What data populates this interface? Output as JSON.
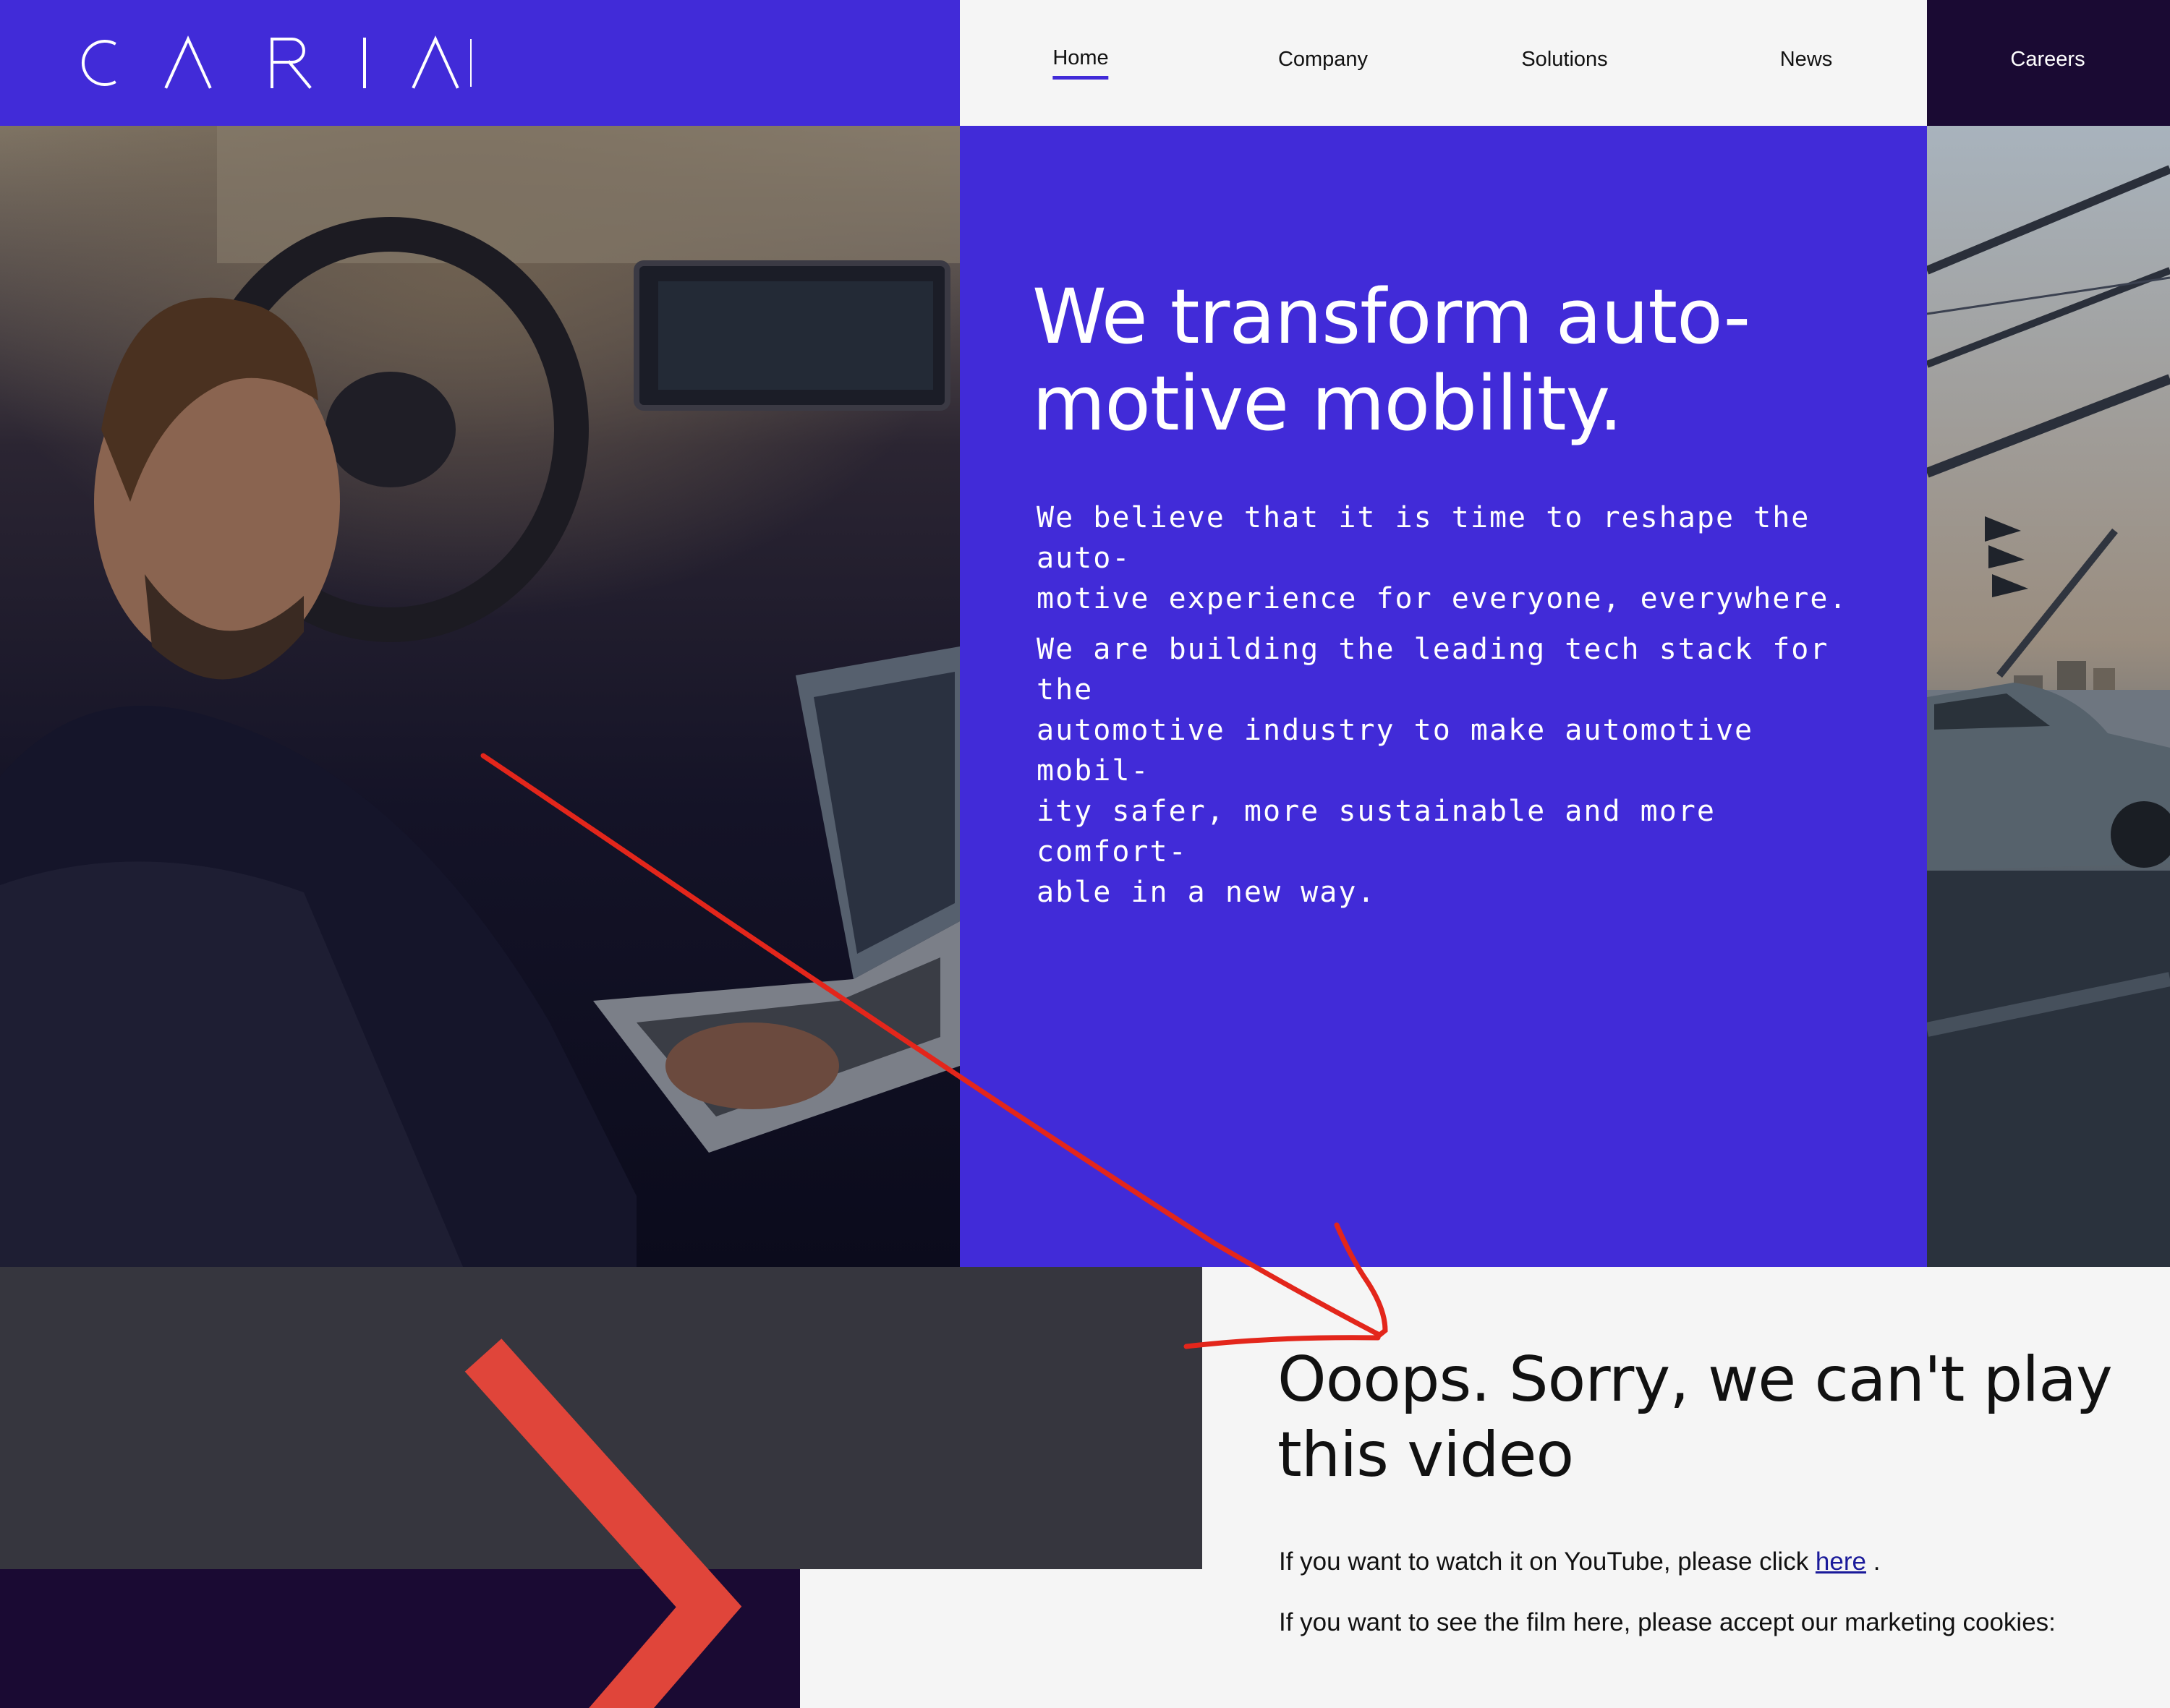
{
  "header": {
    "logo_text": "CARIAD",
    "nav": {
      "home": "Home",
      "company": "Company",
      "solutions": "Solutions",
      "news": "News",
      "careers": "Careers"
    },
    "active_item": "Home"
  },
  "hero": {
    "title_line1": "We transform auto-",
    "title_line2": "motive mobility.",
    "paragraph1_line1": "We believe that it is time to reshape the auto-",
    "paragraph1_line2": "motive experience for everyone, everywhere.",
    "paragraph2_line1": "We are building the leading tech stack for the",
    "paragraph2_line2": "automotive industry to make automotive mobil-",
    "paragraph2_line3": "ity safer, more sustainable and more comfort-",
    "paragraph2_line4": "able in a new way."
  },
  "video_notice": {
    "title_line1": "Ooops. Sorry, we can't play",
    "title_line2": "this video",
    "youtube_prefix": "If you want to watch it on YouTube, please click ",
    "youtube_link": "here",
    "youtube_suffix": " .",
    "cookie_text": "If you want to see the film here, please accept our marketing cookies:"
  },
  "images": {
    "left_photo": "man-in-car-with-laptop-photo",
    "right_photo": "car-on-bridge-photo"
  },
  "colors": {
    "brand_purple": "#412bd8",
    "deep_purple": "#1a0a33",
    "dark_gray": "#36363e",
    "accent_red": "#e0453a",
    "annotation_red": "#e3261b",
    "light_bg": "#f5f5f5"
  }
}
